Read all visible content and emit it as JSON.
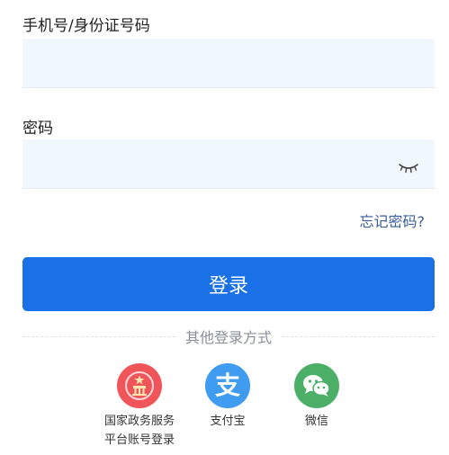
{
  "phone": {
    "label": "手机号/身份证号码",
    "value": "",
    "placeholder": ""
  },
  "password": {
    "label": "密码",
    "value": "",
    "placeholder": ""
  },
  "forgot_password": "忘记密码?",
  "login_button": "登录",
  "divider": "其他登录方式",
  "providers": [
    {
      "line1": "国家政务服务",
      "line2": "平台账号登录",
      "icon": "national-emblem-icon",
      "color": "#f0555a"
    },
    {
      "line1": "支付宝",
      "icon": "alipay-icon",
      "glyph": "支",
      "color": "#3f9cf0"
    },
    {
      "line1": "微信",
      "icon": "wechat-icon",
      "color": "#4caf68"
    }
  ]
}
